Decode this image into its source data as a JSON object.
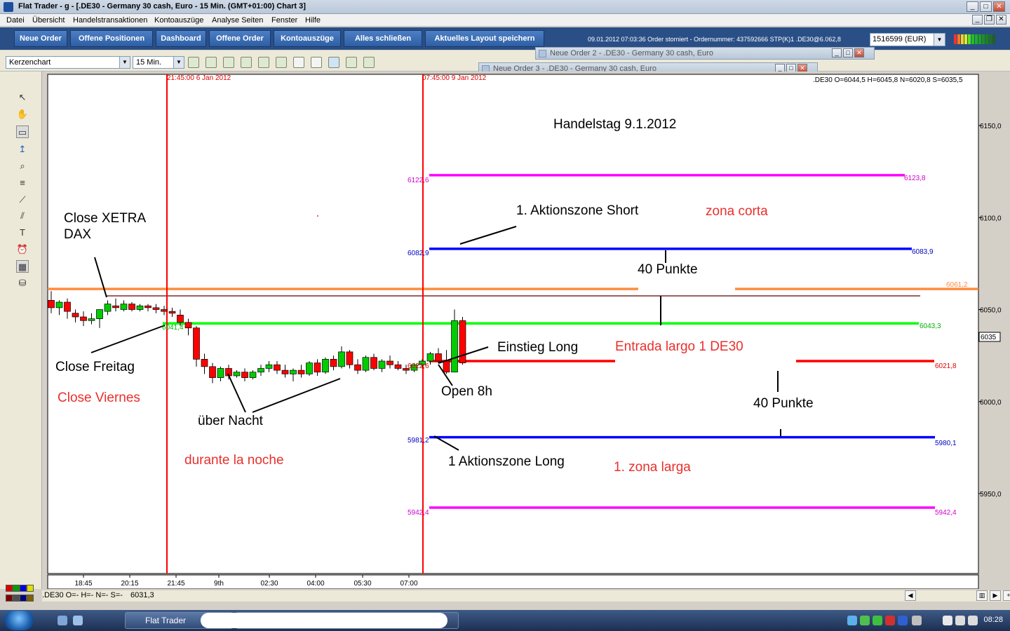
{
  "window": {
    "title": "Flat Trader - g            - [.DE30 - Germany 30 cash, Euro - 15 Min. (GMT+01:00)   Chart 3]"
  },
  "menu": [
    "Datei",
    "Übersicht",
    "Handelstransaktionen",
    "Kontoauszüge",
    "Analyse Seiten",
    "Fenster",
    "Hilfe"
  ],
  "toolbar": {
    "buttons": [
      "Neue Order",
      "Offene Positionen",
      "Dashboard",
      "Offene Order",
      "Kontoauszüge",
      "Alles schließen",
      "Aktuelles Layout speichern"
    ],
    "status_message": "09.01.2012 07:03:36 Order storniert - Ordernummer: 437592666 STP(K)1 .DE30@6.062,8",
    "account": "1516599 (EUR)"
  },
  "chart_toolbar": {
    "chart_type": "Kerzenchart",
    "timeframe": "15 Min."
  },
  "floating_windows": [
    {
      "title": "Neue Order 2 - .DE30 - Germany 30 cash, Euro"
    },
    {
      "title": "Neue Order 3 - .DE30 - Germany 30 cash, Euro"
    }
  ],
  "chart": {
    "ohlc_header": ".DE30 O=6044,5 H=6045,8 N=6020,8 S=6035,5",
    "status_quote": ".DE30 O=- H=- N=- S=-",
    "status_last": "6031,3",
    "current_price_tag": "6035",
    "vline_labels": [
      "21:45:00 6 Jan 2012",
      "07:45:00 9 Jan 2012"
    ],
    "level_labels": {
      "l6122": "6122,6",
      "l6123": "6123,8",
      "l6082": "6082,9",
      "l6083": "6083,9",
      "l6061": "6061,2",
      "l6041": "6041,4",
      "l6043": "6043,3",
      "l6021": "6021,8",
      "l6022": "6022,6",
      "l5981": "5981,2",
      "l5980": "5980,1",
      "l5942a": "5942,4",
      "l5942b": "5942,4"
    },
    "annotations": {
      "title": "Handelstag 9.1.2012",
      "close_xetra_1": "Close XETRA",
      "close_xetra_2": "DAX",
      "aktionszone_short": "1. Aktionszone Short",
      "zona_corta": "zona corta",
      "punkte_top": "40 Punkte",
      "einstieg_long": "Einstieg Long",
      "entrada_largo": "Entrada largo 1 DE30",
      "close_freitag": "Close Freitag",
      "close_viernes": "Close Viernes",
      "open_8h": "Open 8h",
      "punkte_bottom": "40 Punkte",
      "ueber_nacht": "über Nacht",
      "aktionszone_long": "1 Aktionszone Long",
      "durante_noche": "durante la noche",
      "zona_larga": "1. zona larga"
    }
  },
  "chart_data": {
    "type": "candlestick",
    "title": "",
    "y_ticks": [
      "6150,0",
      "6100,0",
      "6050,0",
      "6000,0",
      "5950,0"
    ],
    "x_ticks": [
      "18:45",
      "20:15",
      "21:45",
      "9th",
      "02:30",
      "04:00",
      "05:30",
      "07:00"
    ],
    "candles": [
      {
        "o": 6055,
        "h": 6060,
        "c": 6051,
        "l": 6048
      },
      {
        "o": 6051,
        "h": 6055,
        "c": 6054,
        "l": 6047
      },
      {
        "o": 6054,
        "h": 6056,
        "c": 6049,
        "l": 6045
      },
      {
        "o": 6048,
        "h": 6050,
        "c": 6046,
        "l": 6043
      },
      {
        "o": 6046,
        "h": 6049,
        "c": 6044,
        "l": 6041
      },
      {
        "o": 6044,
        "h": 6048,
        "c": 6045,
        "l": 6042
      },
      {
        "o": 6045,
        "h": 6049,
        "c": 6050,
        "l": 6040
      },
      {
        "o": 6049,
        "h": 6055,
        "c": 6053,
        "l": 6047
      },
      {
        "o": 6052,
        "h": 6056,
        "c": 6051,
        "l": 6049
      },
      {
        "o": 6050,
        "h": 6055,
        "c": 6053,
        "l": 6049
      },
      {
        "o": 6053,
        "h": 6054,
        "c": 6050,
        "l": 6049
      },
      {
        "o": 6050,
        "h": 6053,
        "c": 6052,
        "l": 6049
      },
      {
        "o": 6052,
        "h": 6053,
        "c": 6051,
        "l": 6049
      },
      {
        "o": 6051,
        "h": 6053,
        "c": 6050,
        "l": 6048
      },
      {
        "o": 6050,
        "h": 6052,
        "c": 6049,
        "l": 6047
      },
      {
        "o": 6049,
        "h": 6051,
        "c": 6048,
        "l": 6046
      },
      {
        "o": 6047,
        "h": 6050,
        "c": 6043,
        "l": 6041
      },
      {
        "o": 6043,
        "h": 6045,
        "c": 6040,
        "l": 6036
      },
      {
        "o": 6040,
        "h": 6041,
        "c": 6023,
        "l": 6019
      },
      {
        "o": 6023,
        "h": 6026,
        "c": 6019,
        "l": 6015
      },
      {
        "o": 6019,
        "h": 6021,
        "c": 6013,
        "l": 6010
      },
      {
        "o": 6013,
        "h": 6019,
        "c": 6018,
        "l": 6011
      },
      {
        "o": 6018,
        "h": 6020,
        "c": 6014,
        "l": 6012
      },
      {
        "o": 6014,
        "h": 6017,
        "c": 6016,
        "l": 6013
      },
      {
        "o": 6016,
        "h": 6018,
        "c": 6013,
        "l": 6011
      },
      {
        "o": 6013,
        "h": 6017,
        "c": 6016,
        "l": 6012
      },
      {
        "o": 6016,
        "h": 6020,
        "c": 6018,
        "l": 6014
      },
      {
        "o": 6018,
        "h": 6022,
        "c": 6020,
        "l": 6016
      },
      {
        "o": 6020,
        "h": 6022,
        "c": 6017,
        "l": 6015
      },
      {
        "o": 6017,
        "h": 6020,
        "c": 6015,
        "l": 6013
      },
      {
        "o": 6015,
        "h": 6018,
        "c": 6017,
        "l": 6011
      },
      {
        "o": 6017,
        "h": 6020,
        "c": 6015,
        "l": 6013
      },
      {
        "o": 6015,
        "h": 6022,
        "c": 6021,
        "l": 6014
      },
      {
        "o": 6021,
        "h": 6023,
        "c": 6016,
        "l": 6014
      },
      {
        "o": 6016,
        "h": 6024,
        "c": 6023,
        "l": 6015
      },
      {
        "o": 6023,
        "h": 6025,
        "c": 6019,
        "l": 6017
      },
      {
        "o": 6019,
        "h": 6030,
        "c": 6027,
        "l": 6018
      },
      {
        "o": 6027,
        "h": 6028,
        "c": 6020,
        "l": 6018
      },
      {
        "o": 6020,
        "h": 6023,
        "c": 6017,
        "l": 6015
      },
      {
        "o": 6017,
        "h": 6025,
        "c": 6024,
        "l": 6016
      },
      {
        "o": 6024,
        "h": 6026,
        "c": 6018,
        "l": 6017
      },
      {
        "o": 6018,
        "h": 6023,
        "c": 6022,
        "l": 6016
      },
      {
        "o": 6022,
        "h": 6025,
        "c": 6020,
        "l": 6018
      },
      {
        "o": 6020,
        "h": 6022,
        "c": 6018,
        "l": 6017
      },
      {
        "o": 6018,
        "h": 6020,
        "c": 6017,
        "l": 6015
      },
      {
        "o": 6017,
        "h": 6021,
        "c": 6020,
        "l": 6016
      },
      {
        "o": 6020,
        "h": 6023,
        "c": 6022,
        "l": 6018
      },
      {
        "o": 6022,
        "h": 6027,
        "c": 6026,
        "l": 6020
      },
      {
        "o": 6026,
        "h": 6029,
        "c": 6022,
        "l": 6021
      },
      {
        "o": 6022,
        "h": 6028,
        "c": 6016,
        "l": 6015
      },
      {
        "o": 6016,
        "h": 6050,
        "c": 6044,
        "l": 6022
      },
      {
        "o": 6044,
        "h": 6046,
        "c": 6021,
        "l": 6020
      }
    ],
    "levels": [
      {
        "value": 6123,
        "color": "#ff00ff"
      },
      {
        "value": 6083,
        "color": "#0000ff"
      },
      {
        "value": 6061.2,
        "color": "#ff8c40"
      },
      {
        "value": 6042.5,
        "color": "#00ff00"
      },
      {
        "value": 6022,
        "color": "#ff0000"
      },
      {
        "value": 5980.6,
        "color": "#0000ff"
      },
      {
        "value": 5942.4,
        "color": "#ff00ff"
      }
    ],
    "vlines": [
      "21:45:00 6 Jan 2012",
      "07:45:00 9 Jan 2012"
    ],
    "colors": {
      "up": "#00cc00",
      "down": "#ff0000",
      "vline": "#ff0000"
    }
  }
}
